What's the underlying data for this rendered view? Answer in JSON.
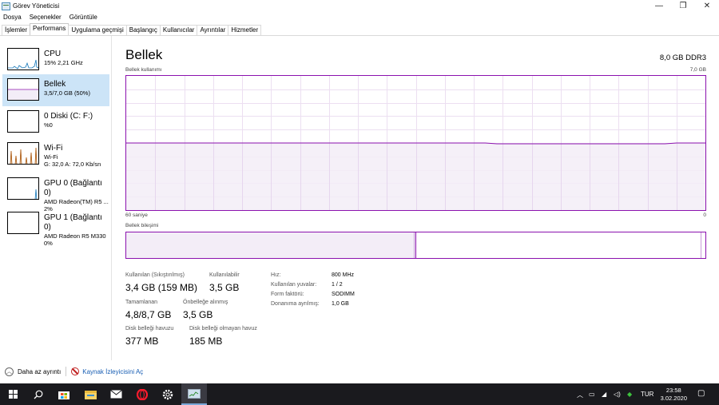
{
  "window": {
    "title": "Görev Yöneticisi",
    "controls": {
      "minimize": "—",
      "maximize": "❐",
      "close": "✕"
    }
  },
  "menu": [
    "Dosya",
    "Seçenekler",
    "Görüntüle"
  ],
  "tabs": [
    {
      "label": "İşlemler",
      "active": false
    },
    {
      "label": "Performans",
      "active": true
    },
    {
      "label": "Uygulama geçmişi",
      "active": false
    },
    {
      "label": "Başlangıç",
      "active": false
    },
    {
      "label": "Kullanıcılar",
      "active": false
    },
    {
      "label": "Ayrıntılar",
      "active": false
    },
    {
      "label": "Hizmetler",
      "active": false
    }
  ],
  "sidebar": {
    "items": [
      {
        "title": "CPU",
        "line1": "15% 2,21 GHz",
        "line2": "",
        "color": "#1779ba",
        "fill": "#f1f6fb",
        "selected": false
      },
      {
        "title": "Bellek",
        "line1": "3,5/7,0 GB (50%)",
        "line2": "",
        "color": "#8b12ae",
        "fill": "#f3edf7",
        "selected": true
      },
      {
        "title": "0 Diski (C: F:)",
        "line1": "%0",
        "line2": "",
        "color": "#4da60c",
        "fill": "#ffffff",
        "selected": false
      },
      {
        "title": "Wi-Fi",
        "line1": "Wi-Fi",
        "line2": "G: 32,0 A: 72,0 Kb/sn",
        "color": "#a74f01",
        "fill": "#fbf3ea",
        "selected": false
      },
      {
        "title": "GPU 0 (Bağlantı 0)",
        "line1": "AMD Radeon(TM) R5 ...",
        "line2": "2%",
        "color": "#1779ba",
        "fill": "#f1f6fb",
        "selected": false
      },
      {
        "title": "GPU 1 (Bağlantı 0)",
        "line1": "AMD Radeon R5 M330",
        "line2": "0%",
        "color": "#1779ba",
        "fill": "#f1f6fb",
        "selected": false
      }
    ]
  },
  "main": {
    "title": "Bellek",
    "spec": "8,0 GB DDR3",
    "usage_label": "Bellek kullanımı",
    "usage_max": "7,0 GB",
    "time_left": "60 saniye",
    "time_right": "0",
    "usage_fraction": 0.5,
    "composition_label": "Bellek bileşimi",
    "composition": {
      "in_use_fraction": 0.496,
      "modified_fraction": 0.004,
      "free_fraction": 0.5
    }
  },
  "stats": {
    "in_use_label": "Kullanılan (Sıkıştırılmış)",
    "in_use_value": "3,4 GB (159 MB)",
    "available_label": "Kullanılabilir",
    "available_value": "3,5 GB",
    "committed_label": "Tamamlanan",
    "committed_value": "4,8/8,7 GB",
    "cached_label": "Önbelleğe alınmış",
    "cached_value": "3,5 GB",
    "paged_label": "Disk belleği havuzu",
    "paged_value": "377 MB",
    "nonpaged_label": "Disk belleği olmayan havuz",
    "nonpaged_value": "185 MB"
  },
  "specs": [
    {
      "label": "Hız:",
      "value": "800 MHz"
    },
    {
      "label": "Kullanılan yuvalar:",
      "value": "1 / 2"
    },
    {
      "label": "Form faktörü:",
      "value": "SODIMM"
    },
    {
      "label": "Donanıma ayrılmış:",
      "value": "1,0 GB"
    }
  ],
  "footer": {
    "fewer_details": "Daha az ayrıntı",
    "resource_monitor": "Kaynak İzleyicisini Aç"
  },
  "taskbar": {
    "icons": [
      "windows-start-icon",
      "search-icon",
      "store-icon",
      "file-explorer-icon",
      "mail-icon",
      "opera-icon",
      "settings-icon",
      "task-manager-icon"
    ],
    "language": "TUR",
    "time": "23:58",
    "date": "3.02.2020"
  }
}
